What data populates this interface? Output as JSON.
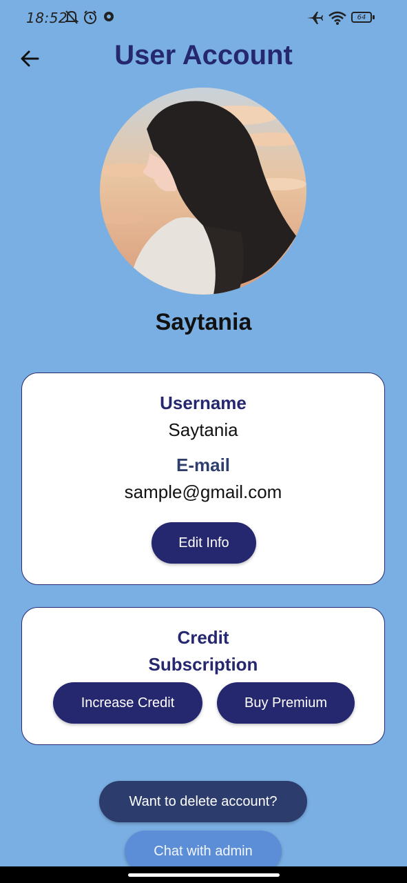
{
  "status_bar": {
    "time": "18:52",
    "battery": "64",
    "icons": [
      "bell-off-icon",
      "alarm-icon",
      "chat-bubble-icon",
      "airplane-icon",
      "wifi-icon",
      "battery-icon"
    ]
  },
  "header": {
    "title": "User Account",
    "back_icon": "arrow-left-icon"
  },
  "profile": {
    "display_name": "Saytania"
  },
  "info_card": {
    "username_label": "Username",
    "username_value": "Saytania",
    "email_label": "E-mail",
    "email_value": "sample@gmail.com",
    "edit_button": "Edit Info"
  },
  "subscription_card": {
    "line1": "Credit",
    "line2": "Subscription",
    "increase_button": "Increase Credit",
    "premium_button": "Buy Premium"
  },
  "footer": {
    "delete_button": "Want to delete account?",
    "chat_button": "Chat with admin"
  },
  "colors": {
    "background": "#7aafe3",
    "primary": "#26286f",
    "delete_button": "#2c3c6c",
    "chat_button": "#5b8ed7"
  }
}
